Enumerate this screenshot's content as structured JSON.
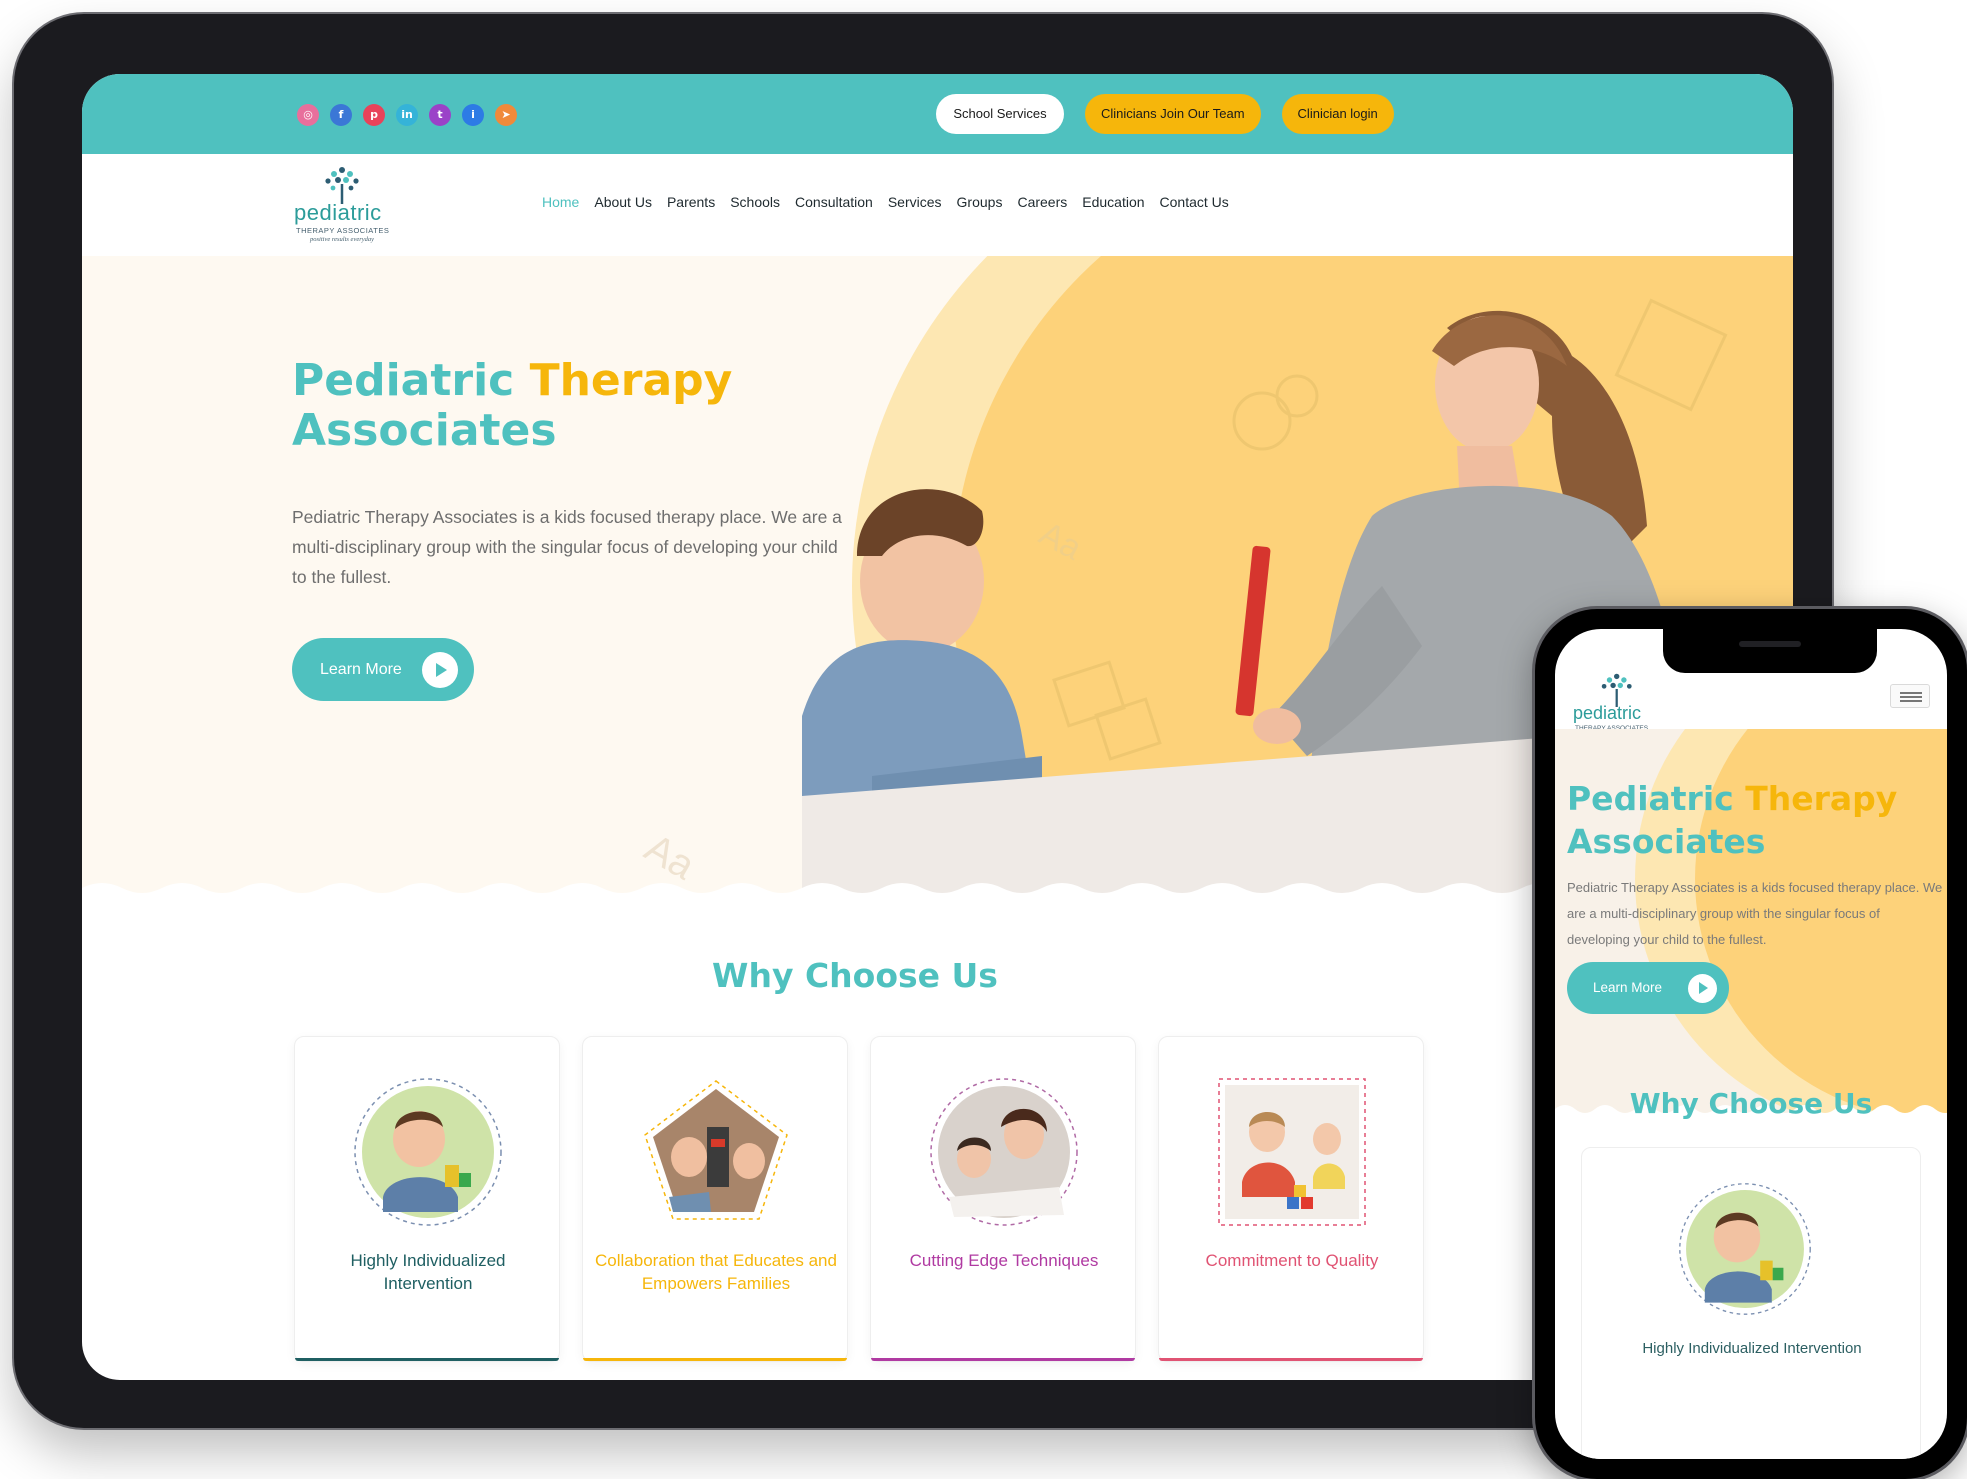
{
  "colors": {
    "teal": "#4fc1bf",
    "yellow": "#f6b60b",
    "dark_teal": "#1f5f62",
    "purple": "#b03aa2",
    "pink": "#e05373"
  },
  "topbar": {
    "socials": [
      "instagram-icon",
      "facebook-icon",
      "pinterest-icon",
      "linkedin-icon",
      "twitter-icon",
      "info-icon",
      "location-icon"
    ],
    "school_services": "School Services",
    "join_team": "Clinicians Join Our Team",
    "clinician_login": "Clinician login"
  },
  "logo": {
    "word": "pediatric",
    "subtitle": "THERAPY ASSOCIATES",
    "tagline": "positive results everyday"
  },
  "nav": {
    "items": [
      "Home",
      "About Us",
      "Parents",
      "Schools",
      "Consultation",
      "Services",
      "Groups",
      "Careers",
      "Education",
      "Contact Us"
    ],
    "active": "Home"
  },
  "hero": {
    "title_part1": "Pediatric",
    "title_part2": "Therapy",
    "title_part3": "Associates",
    "description": "Pediatric Therapy Associates is a kids focused therapy place. We are a multi-disciplinary group with the singular focus of developing your child to the fullest.",
    "cta": "Learn More"
  },
  "why": {
    "title": "Why Choose Us",
    "cards": [
      {
        "label": "Highly Individualized Intervention",
        "color": "#1f5f62"
      },
      {
        "label": "Collaboration that Educates and Empowers Families",
        "color": "#f6b60b"
      },
      {
        "label": "Cutting Edge Techniques",
        "color": "#b03aa2"
      },
      {
        "label": "Commitment to Quality",
        "color": "#e05373"
      }
    ]
  },
  "mobile": {
    "title_part1": "Pediatric",
    "title_part2": "Therapy",
    "title_part3": "Associates",
    "description": "Pediatric Therapy Associates is a kids focused therapy place. We are a multi-disciplinary group with the singular focus of developing your child to the fullest.",
    "cta": "Learn More",
    "why_title": "Why Choose Us",
    "first_card_label": "Highly Individualized Intervention"
  }
}
